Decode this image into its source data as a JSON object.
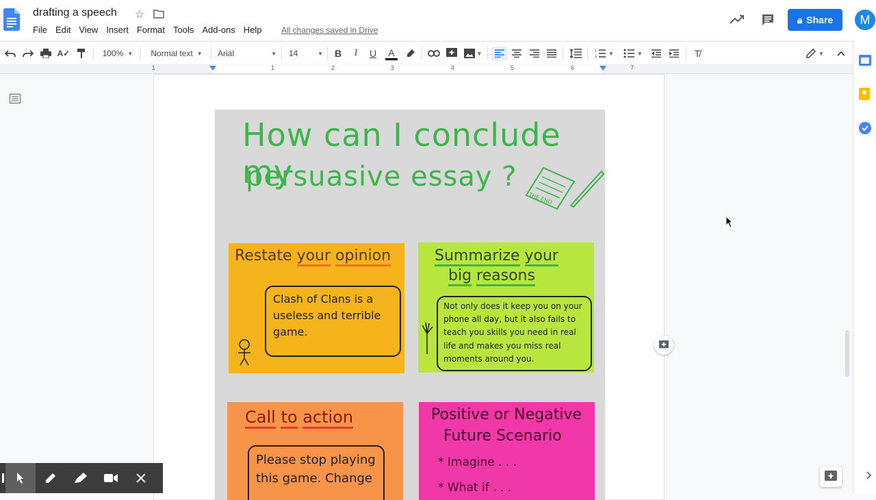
{
  "header": {
    "title": "drafting a speech",
    "menus": [
      "File",
      "Edit",
      "View",
      "Insert",
      "Format",
      "Tools",
      "Add-ons",
      "Help"
    ],
    "saved_status": "All changes saved in Drive",
    "share_label": "Share",
    "avatar_letter": "M"
  },
  "toolbar": {
    "zoom": "100%",
    "style": "Normal text",
    "font": "Arial",
    "size": "14"
  },
  "ruler": {
    "numbers": [
      "1",
      "1",
      "2",
      "3",
      "4",
      "5",
      "6",
      "7"
    ]
  },
  "poster": {
    "question_line1": "How can I conclude my",
    "question_line2": "persuasive essay ?",
    "note_label": "THE END",
    "s1_title_1": "Restate",
    "s1_title_2": "your",
    "s1_title_3": "opinion",
    "s1_bubble": "Clash of Clans is a useless and terrible game.",
    "s2_title_1": "Summarize",
    "s2_title_2": "your",
    "s2_title_3": "big",
    "s2_title_4": "reasons",
    "s2_bubble": "Not only does it keep you on your phone all day, but it also fails to teach you skills you need in real life and makes you miss real moments around you.",
    "s3_title_1": "Call",
    "s3_title_2": "to",
    "s3_title_3": "action",
    "s3_bubble": "Please stop playing this game. Change",
    "s4_title_1": "Positive or Negative",
    "s4_title_2": "Future Scenario",
    "s4_item1": "* Imagine . . .",
    "s4_item2": "* What if . . ."
  },
  "colors": {
    "accent": "#1a73e8",
    "green_marker": "#3cb54a"
  }
}
